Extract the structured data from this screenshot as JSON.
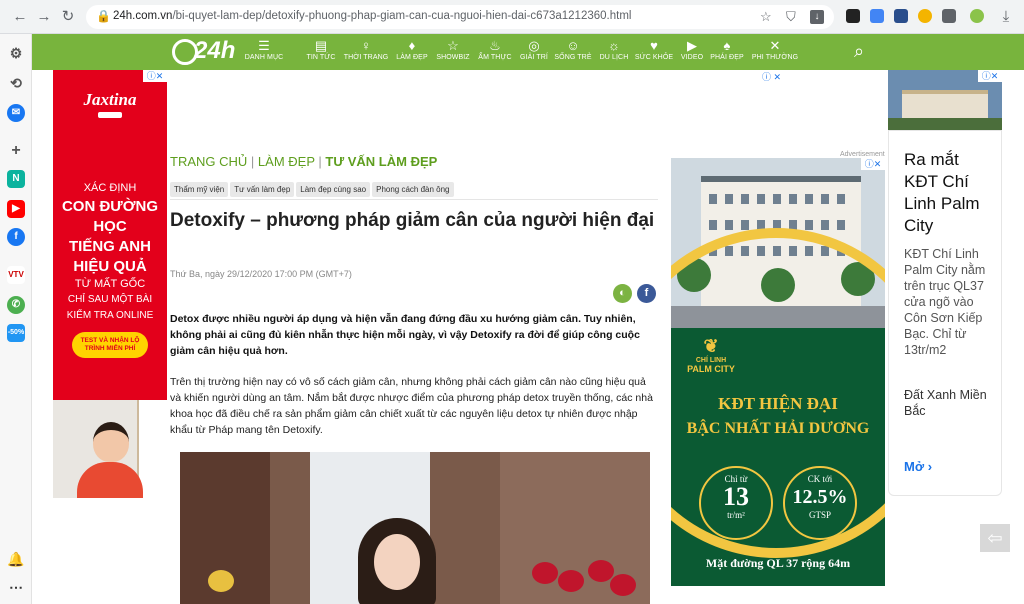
{
  "browser": {
    "url_host": "24h.com.vn",
    "url_path": "/bi-quyet-lam-dep/detoxify-phuong-phap-giam-can-cua-nguoi-hien-dai-c673a1212360.html"
  },
  "site": {
    "logo_text": "24h",
    "nav": [
      {
        "icon": "☰",
        "label": "DANH MỤC"
      },
      {
        "icon": "▤",
        "label": "TIN TỨC"
      },
      {
        "icon": "♀",
        "label": "THỜI TRANG"
      },
      {
        "icon": "♦",
        "label": "LÀM ĐẸP"
      },
      {
        "icon": "☆",
        "label": "SHOWBIZ"
      },
      {
        "icon": "♨",
        "label": "ẨM THỰC"
      },
      {
        "icon": "◎",
        "label": "GIẢI TRÍ"
      },
      {
        "icon": "☺",
        "label": "SỐNG TRẺ"
      },
      {
        "icon": "☼",
        "label": "DU LỊCH"
      },
      {
        "icon": "♥",
        "label": "SỨC KHỎE"
      },
      {
        "icon": "▶",
        "label": "VIDEO"
      },
      {
        "icon": "♠",
        "label": "PHÁI ĐẸP"
      },
      {
        "icon": "✕",
        "label": "PHI THƯỜNG"
      }
    ]
  },
  "left_ad": {
    "brand": "Jaxtina",
    "lines": [
      "XÁC ĐỊNH",
      "CON ĐƯỜNG",
      "HỌC",
      "TIẾNG ANH",
      "HIỆU QUẢ",
      "TỪ MẤT GỐC",
      "CHỈ SAU MỘT BÀI",
      "KIỂM TRA ONLINE"
    ],
    "button": "TEST VÀ NHẬN LỘ TRÌNH MIỄN PHÍ"
  },
  "article": {
    "breadcrumb_home": "TRANG CHỦ",
    "breadcrumb_cat": "LÀM ĐẸP",
    "breadcrumb_sub": "TƯ VẤN LÀM ĐẸP",
    "tags": [
      "Thẩm mỹ viện",
      "Tư vấn làm đẹp",
      "Làm đẹp cùng sao",
      "Phong cách đàn ông"
    ],
    "title": "Detoxify – phương pháp giảm cân của người hiện đại",
    "date": "Thứ Ba, ngày 29/12/2020 17:00 PM (GMT+7)",
    "lead": "Detox được nhiều người áp dụng và hiện vẫn đang đứng đầu xu hướng giảm cân. Tuy nhiên, không phải ai cũng đủ kiên nhẫn thực hiện mỗi ngày, vì vậy Detoxify ra đời để giúp công cuộc giảm cân hiệu quả hơn.",
    "body": "Trên thị trường hiện nay có vô số cách giảm cân, nhưng không phải cách giảm cân nào cũng hiệu quả và khiến người dùng an tâm. Nắm bắt được nhược điểm của phương pháp detox truyền thống, các nhà khoa học đã điều chế ra sản phẩm giảm cân chiết xuất từ các nguyên liệu detox tự nhiên được nhập khẩu từ Pháp mang tên Detoxify."
  },
  "mid_ad": {
    "label": "Advertisement",
    "logo_line1": "CHÍ LINH",
    "logo_line2": "PALM CITY",
    "headline1": "KĐT HIỆN ĐẠI",
    "headline2": "BẬC NHẤT HẢI DƯƠNG",
    "price_top": "Chỉ từ",
    "price_value": "13",
    "price_unit": "tr/m²",
    "ck_top": "CK tới",
    "ck_value": "12.5%",
    "ck_unit": "GTSP",
    "footer": "Mặt đường QL 37 rộng 64m"
  },
  "right_ad": {
    "title": "Ra mắt KĐT Chí Linh Palm City",
    "description": "KĐT Chí Linh Palm City nằm trên trục QL37 cửa ngõ vào Côn Sơn Kiếp Bạc. Chỉ từ 13tr/m2",
    "advertiser": "Đất Xanh Miền Bắc",
    "more": "Mở"
  }
}
